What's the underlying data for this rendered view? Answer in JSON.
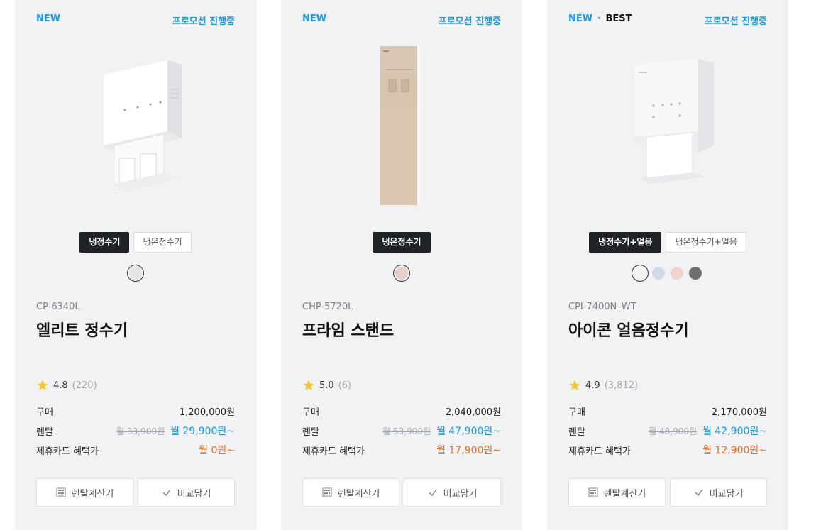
{
  "products": [
    {
      "badges": [
        "NEW"
      ],
      "promo": "프로모션 진행중",
      "types": [
        {
          "label": "냉정수기",
          "active": true
        },
        {
          "label": "냉온정수기",
          "active": false
        }
      ],
      "colors": [
        {
          "hex": "#e4e4e4",
          "selected": true
        }
      ],
      "model": "CP-6340L",
      "name": "엘리트 정수기",
      "rating": "4.8",
      "review_count": "(220)",
      "buy_label": "구매",
      "buy_price": "1,200,000원",
      "rent_label": "렌탈",
      "rent_original": "월 33,900원",
      "rent_price": "월 29,900원~",
      "card_label": "제휴카드 혜택가",
      "card_price": "월 0원~",
      "calc_label": "렌탈계산기",
      "compare_label": "비교담기"
    },
    {
      "badges": [
        "NEW"
      ],
      "promo": "프로모션 진행중",
      "types": [
        {
          "label": "냉온정수기",
          "active": true
        }
      ],
      "colors": [
        {
          "hex": "#e6cfc8",
          "selected": true
        }
      ],
      "model": "CHP-5720L",
      "name": "프라임 스탠드",
      "rating": "5.0",
      "review_count": "(6)",
      "buy_label": "구매",
      "buy_price": "2,040,000원",
      "rent_label": "렌탈",
      "rent_original": "월 53,900원",
      "rent_price": "월 47,900원~",
      "card_label": "제휴카드 혜택가",
      "card_price": "월 17,900원~",
      "calc_label": "렌탈계산기",
      "compare_label": "비교담기"
    },
    {
      "badges": [
        "NEW",
        "BEST"
      ],
      "promo": "프로모션 진행중",
      "types": [
        {
          "label": "냉정수기+얼음",
          "active": true
        },
        {
          "label": "냉온정수기+얼음",
          "active": false
        }
      ],
      "colors": [
        {
          "hex": "#f2f2f2",
          "selected": true
        },
        {
          "hex": "#cfd9ea",
          "selected": false
        },
        {
          "hex": "#f0d3cf",
          "selected": false
        },
        {
          "hex": "#6e6e6e",
          "selected": false
        }
      ],
      "model": "CPI-7400N_WT",
      "name": "아이콘 얼음정수기",
      "rating": "4.9",
      "review_count": "(3,812)",
      "buy_label": "구매",
      "buy_price": "2,170,000원",
      "rent_label": "렌탈",
      "rent_original": "월 48,900원",
      "rent_price": "월 42,900원~",
      "card_label": "제휴카드 혜택가",
      "card_price": "월 12,900원~",
      "calc_label": "렌탈계산기",
      "compare_label": "비교담기"
    }
  ],
  "icons": {
    "star": "star-icon",
    "calculator": "calculator-icon",
    "check": "check-icon"
  },
  "colors": {
    "accent_blue": "#1a9be8",
    "accent_orange": "#f26b1d",
    "card_bg": "#f1f2f4",
    "dark_chip": "#1f2328",
    "star_yellow": "#f5c518"
  }
}
